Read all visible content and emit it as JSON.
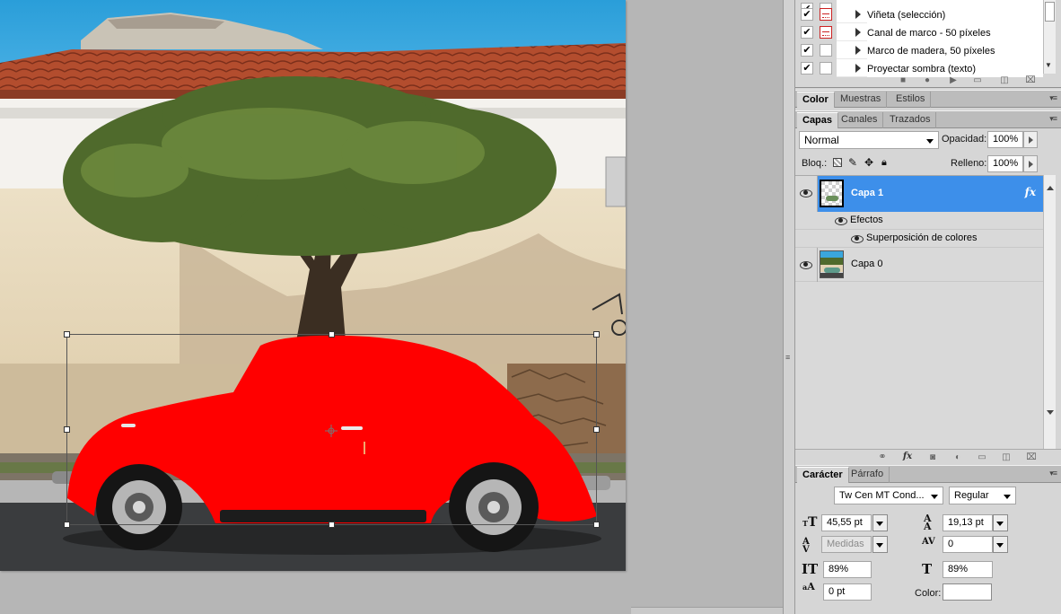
{
  "actions": {
    "items": [
      {
        "label": "Viñeta (selección)",
        "checked": true,
        "dialog": true
      },
      {
        "label": "Canal de marco - 50 píxeles",
        "checked": true,
        "dialog": true
      },
      {
        "label": "Marco de madera, 50 píxeles",
        "checked": true,
        "dialog": false
      },
      {
        "label": "Proyectar sombra (texto)",
        "checked": true,
        "dialog": false
      }
    ],
    "check_glyph": "✔",
    "toolbar_icons": [
      "stop-icon",
      "record-icon",
      "play-icon",
      "new-set-icon",
      "new-action-icon",
      "delete-icon"
    ]
  },
  "color_panel": {
    "tabs": [
      "Color",
      "Muestras",
      "Estilos"
    ],
    "active_tab": "Color"
  },
  "layers_panel": {
    "tabs": [
      "Capas",
      "Canales",
      "Trazados"
    ],
    "active_tab": "Capas",
    "blend_mode": "Normal",
    "opacity_label": "Opacidad:",
    "opacity_value": "100%",
    "lock_label": "Bloq.:",
    "fill_label": "Relleno:",
    "fill_value": "100%",
    "layers": [
      {
        "name": "Capa 1",
        "selected": true,
        "has_fx": true,
        "fx_label": "fx",
        "effects_label": "Efectos",
        "effects": [
          "Superposición de colores"
        ]
      },
      {
        "name": "Capa 0",
        "selected": false,
        "has_fx": false
      }
    ],
    "toolbar_icons": [
      "link-icon",
      "fx-icon",
      "mask-icon",
      "adjustment-icon",
      "group-icon",
      "new-layer-icon",
      "trash-icon"
    ]
  },
  "character_panel": {
    "tabs": [
      "Carácter",
      "Párrafo"
    ],
    "active_tab": "Carácter",
    "font_family": "Tw Cen MT Cond...",
    "font_style": "Regular",
    "font_size": "45,55 pt",
    "leading": "19,13 pt",
    "kerning": "Medidas",
    "tracking": "0",
    "vertical_scale": "89%",
    "horizontal_scale": "89%",
    "baseline_shift": "0 pt",
    "color_label": "Color:"
  },
  "colors": {
    "selected_layer": "#3d8fea",
    "car_fill": "#ff0000",
    "panel_bg": "#d6d6d6"
  }
}
